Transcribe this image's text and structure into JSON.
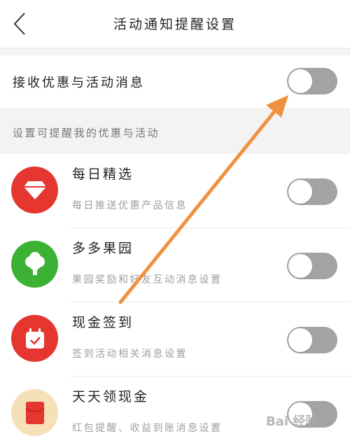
{
  "header": {
    "title": "活动通知提醒设置",
    "back_icon": "chevron-left-icon"
  },
  "master": {
    "label": "接收优惠与活动消息",
    "enabled": false
  },
  "section": {
    "label": "设置可提醒我的优惠与活动"
  },
  "items": [
    {
      "title": "每日精选",
      "desc": "每日推送优惠产品信息",
      "icon": "diamond-icon",
      "icon_color": "#e5362f",
      "enabled": false
    },
    {
      "title": "多多果园",
      "desc": "果园奖励和好友互动消息设置",
      "icon": "tree-icon",
      "icon_color": "#3bb234",
      "enabled": false
    },
    {
      "title": "现金签到",
      "desc": "签到活动相关消息设置",
      "icon": "calendar-check-icon",
      "icon_color": "#e5362f",
      "enabled": false
    },
    {
      "title": "天天领现金",
      "desc": "红包提醒、收益到账消息设置",
      "icon": "red-envelope-icon",
      "icon_color": "#f6e0b8",
      "enabled": false
    }
  ],
  "colors": {
    "toggle_off": "#a3a3a3",
    "arrow": "#f0913e",
    "section_bg": "#f3f3f3"
  },
  "watermark": {
    "text": "Bai 经验"
  }
}
